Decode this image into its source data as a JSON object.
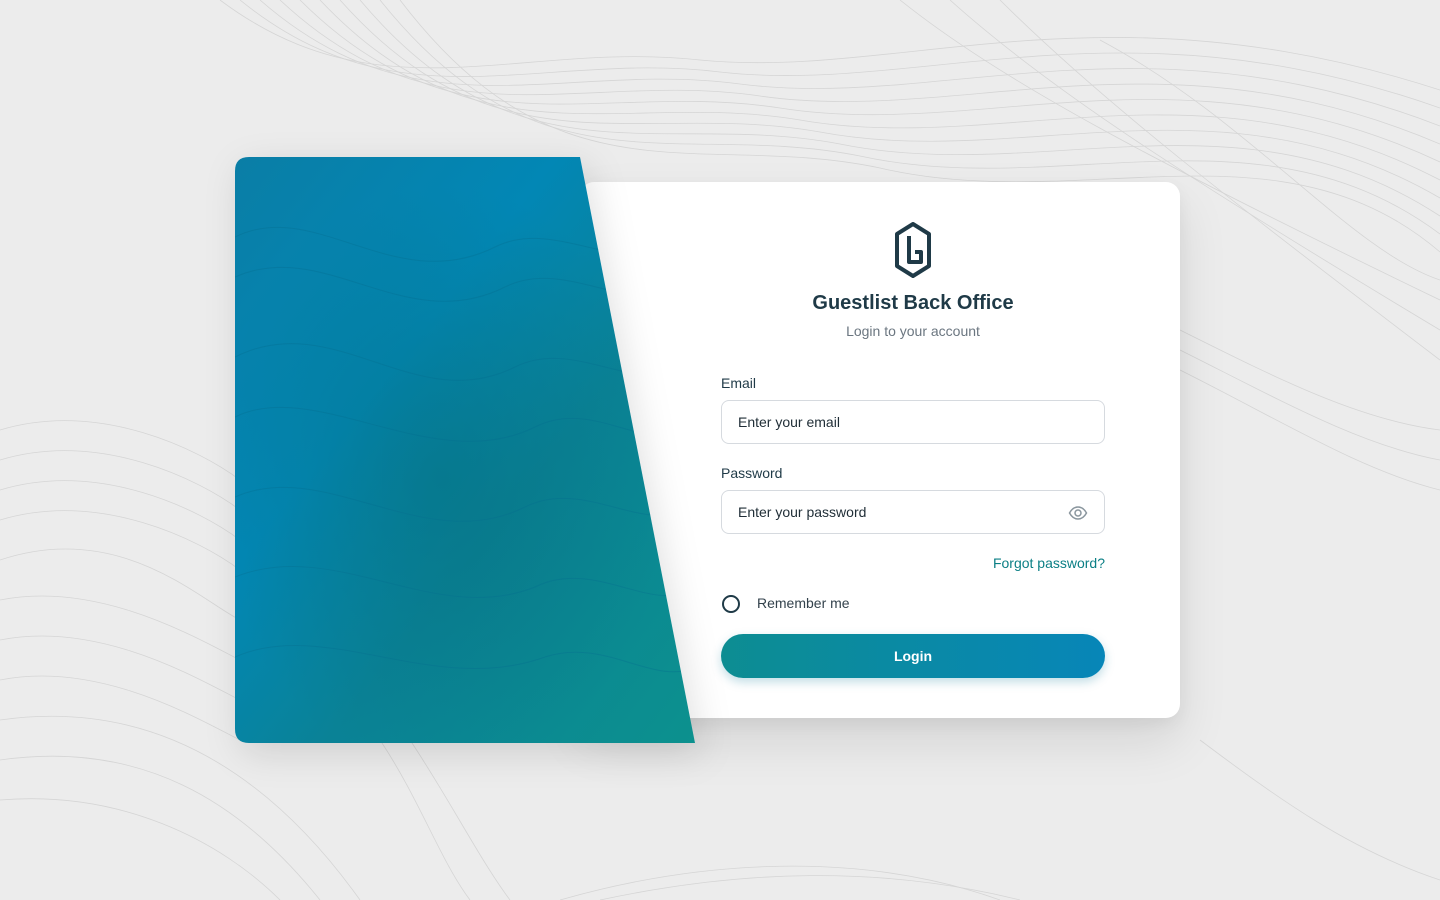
{
  "brand": {
    "title": "Guestlist Back Office",
    "subtitle": "Login to your account",
    "logo_icon": "guestlist-g-logo-icon"
  },
  "form": {
    "email": {
      "label": "Email",
      "placeholder": "Enter your email",
      "value": ""
    },
    "password": {
      "label": "Password",
      "placeholder": "Enter your password",
      "value": "",
      "toggle_icon": "eye-icon"
    },
    "forgot_password": "Forgot password?",
    "remember_me": {
      "label": "Remember me",
      "checked": false
    },
    "submit_label": "Login"
  },
  "colors": {
    "accent_teal": "#0b7f85",
    "accent_blue": "#0786b8",
    "text_dark": "#1f3a47",
    "page_background": "#ececec"
  }
}
